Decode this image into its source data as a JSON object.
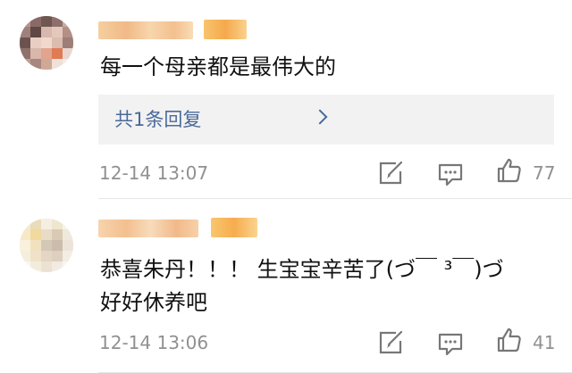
{
  "comments": [
    {
      "text_lines": [
        "每一个母亲都是最伟大的"
      ],
      "reply_label": "共1条回复",
      "time": "12-14 13:07",
      "like_count": "77",
      "icons": [
        "share-icon",
        "comment-icon",
        "like-icon"
      ]
    },
    {
      "text_lines": [
        "恭喜朱丹！！！ 生宝宝辛苦了(づ￣ ³￣)づ",
        "好好休养吧"
      ],
      "time": "12-14 13:06",
      "like_count": "41",
      "icons": [
        "share-icon",
        "comment-icon",
        "like-icon"
      ]
    }
  ],
  "colors": {
    "text": "#111111",
    "meta": "#909090",
    "reply_link": "#4a6a9a",
    "reply_bg": "#f2f2f2"
  }
}
